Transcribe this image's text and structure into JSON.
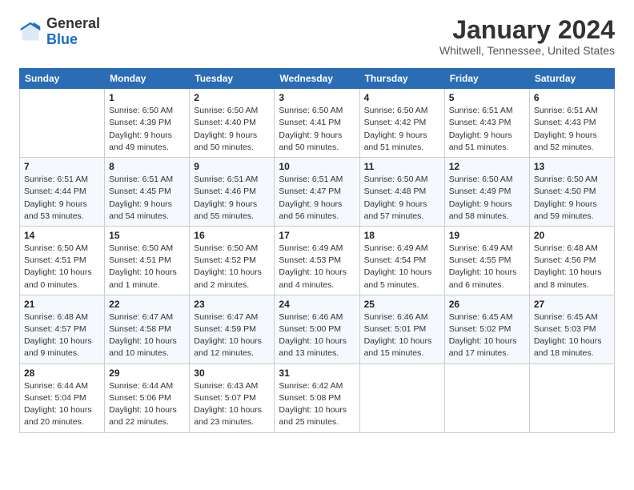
{
  "header": {
    "logo": {
      "general": "General",
      "blue": "Blue"
    },
    "title": "January 2024",
    "location": "Whitwell, Tennessee, United States"
  },
  "weekdays": [
    "Sunday",
    "Monday",
    "Tuesday",
    "Wednesday",
    "Thursday",
    "Friday",
    "Saturday"
  ],
  "weeks": [
    [
      {
        "day": "",
        "sunrise": "",
        "sunset": "",
        "daylight": ""
      },
      {
        "day": "1",
        "sunrise": "Sunrise: 6:50 AM",
        "sunset": "Sunset: 4:39 PM",
        "daylight": "Daylight: 9 hours and 49 minutes."
      },
      {
        "day": "2",
        "sunrise": "Sunrise: 6:50 AM",
        "sunset": "Sunset: 4:40 PM",
        "daylight": "Daylight: 9 hours and 50 minutes."
      },
      {
        "day": "3",
        "sunrise": "Sunrise: 6:50 AM",
        "sunset": "Sunset: 4:41 PM",
        "daylight": "Daylight: 9 hours and 50 minutes."
      },
      {
        "day": "4",
        "sunrise": "Sunrise: 6:50 AM",
        "sunset": "Sunset: 4:42 PM",
        "daylight": "Daylight: 9 hours and 51 minutes."
      },
      {
        "day": "5",
        "sunrise": "Sunrise: 6:51 AM",
        "sunset": "Sunset: 4:43 PM",
        "daylight": "Daylight: 9 hours and 51 minutes."
      },
      {
        "day": "6",
        "sunrise": "Sunrise: 6:51 AM",
        "sunset": "Sunset: 4:43 PM",
        "daylight": "Daylight: 9 hours and 52 minutes."
      }
    ],
    [
      {
        "day": "7",
        "sunrise": "Sunrise: 6:51 AM",
        "sunset": "Sunset: 4:44 PM",
        "daylight": "Daylight: 9 hours and 53 minutes."
      },
      {
        "day": "8",
        "sunrise": "Sunrise: 6:51 AM",
        "sunset": "Sunset: 4:45 PM",
        "daylight": "Daylight: 9 hours and 54 minutes."
      },
      {
        "day": "9",
        "sunrise": "Sunrise: 6:51 AM",
        "sunset": "Sunset: 4:46 PM",
        "daylight": "Daylight: 9 hours and 55 minutes."
      },
      {
        "day": "10",
        "sunrise": "Sunrise: 6:51 AM",
        "sunset": "Sunset: 4:47 PM",
        "daylight": "Daylight: 9 hours and 56 minutes."
      },
      {
        "day": "11",
        "sunrise": "Sunrise: 6:50 AM",
        "sunset": "Sunset: 4:48 PM",
        "daylight": "Daylight: 9 hours and 57 minutes."
      },
      {
        "day": "12",
        "sunrise": "Sunrise: 6:50 AM",
        "sunset": "Sunset: 4:49 PM",
        "daylight": "Daylight: 9 hours and 58 minutes."
      },
      {
        "day": "13",
        "sunrise": "Sunrise: 6:50 AM",
        "sunset": "Sunset: 4:50 PM",
        "daylight": "Daylight: 9 hours and 59 minutes."
      }
    ],
    [
      {
        "day": "14",
        "sunrise": "Sunrise: 6:50 AM",
        "sunset": "Sunset: 4:51 PM",
        "daylight": "Daylight: 10 hours and 0 minutes."
      },
      {
        "day": "15",
        "sunrise": "Sunrise: 6:50 AM",
        "sunset": "Sunset: 4:51 PM",
        "daylight": "Daylight: 10 hours and 1 minute."
      },
      {
        "day": "16",
        "sunrise": "Sunrise: 6:50 AM",
        "sunset": "Sunset: 4:52 PM",
        "daylight": "Daylight: 10 hours and 2 minutes."
      },
      {
        "day": "17",
        "sunrise": "Sunrise: 6:49 AM",
        "sunset": "Sunset: 4:53 PM",
        "daylight": "Daylight: 10 hours and 4 minutes."
      },
      {
        "day": "18",
        "sunrise": "Sunrise: 6:49 AM",
        "sunset": "Sunset: 4:54 PM",
        "daylight": "Daylight: 10 hours and 5 minutes."
      },
      {
        "day": "19",
        "sunrise": "Sunrise: 6:49 AM",
        "sunset": "Sunset: 4:55 PM",
        "daylight": "Daylight: 10 hours and 6 minutes."
      },
      {
        "day": "20",
        "sunrise": "Sunrise: 6:48 AM",
        "sunset": "Sunset: 4:56 PM",
        "daylight": "Daylight: 10 hours and 8 minutes."
      }
    ],
    [
      {
        "day": "21",
        "sunrise": "Sunrise: 6:48 AM",
        "sunset": "Sunset: 4:57 PM",
        "daylight": "Daylight: 10 hours and 9 minutes."
      },
      {
        "day": "22",
        "sunrise": "Sunrise: 6:47 AM",
        "sunset": "Sunset: 4:58 PM",
        "daylight": "Daylight: 10 hours and 10 minutes."
      },
      {
        "day": "23",
        "sunrise": "Sunrise: 6:47 AM",
        "sunset": "Sunset: 4:59 PM",
        "daylight": "Daylight: 10 hours and 12 minutes."
      },
      {
        "day": "24",
        "sunrise": "Sunrise: 6:46 AM",
        "sunset": "Sunset: 5:00 PM",
        "daylight": "Daylight: 10 hours and 13 minutes."
      },
      {
        "day": "25",
        "sunrise": "Sunrise: 6:46 AM",
        "sunset": "Sunset: 5:01 PM",
        "daylight": "Daylight: 10 hours and 15 minutes."
      },
      {
        "day": "26",
        "sunrise": "Sunrise: 6:45 AM",
        "sunset": "Sunset: 5:02 PM",
        "daylight": "Daylight: 10 hours and 17 minutes."
      },
      {
        "day": "27",
        "sunrise": "Sunrise: 6:45 AM",
        "sunset": "Sunset: 5:03 PM",
        "daylight": "Daylight: 10 hours and 18 minutes."
      }
    ],
    [
      {
        "day": "28",
        "sunrise": "Sunrise: 6:44 AM",
        "sunset": "Sunset: 5:04 PM",
        "daylight": "Daylight: 10 hours and 20 minutes."
      },
      {
        "day": "29",
        "sunrise": "Sunrise: 6:44 AM",
        "sunset": "Sunset: 5:06 PM",
        "daylight": "Daylight: 10 hours and 22 minutes."
      },
      {
        "day": "30",
        "sunrise": "Sunrise: 6:43 AM",
        "sunset": "Sunset: 5:07 PM",
        "daylight": "Daylight: 10 hours and 23 minutes."
      },
      {
        "day": "31",
        "sunrise": "Sunrise: 6:42 AM",
        "sunset": "Sunset: 5:08 PM",
        "daylight": "Daylight: 10 hours and 25 minutes."
      },
      {
        "day": "",
        "sunrise": "",
        "sunset": "",
        "daylight": ""
      },
      {
        "day": "",
        "sunrise": "",
        "sunset": "",
        "daylight": ""
      },
      {
        "day": "",
        "sunrise": "",
        "sunset": "",
        "daylight": ""
      }
    ]
  ]
}
